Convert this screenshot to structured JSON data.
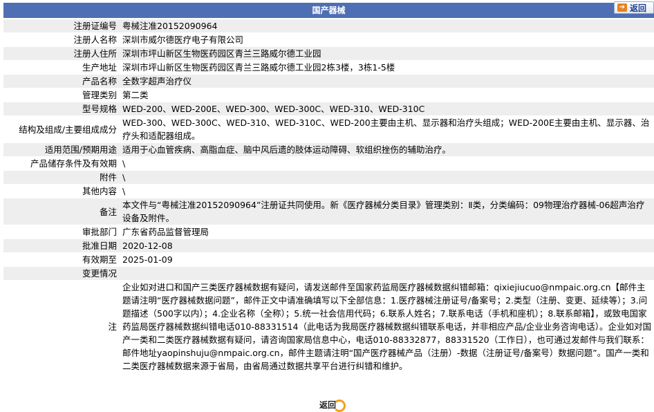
{
  "header": {
    "title": "国产器械",
    "back_label": "返回"
  },
  "rows": [
    {
      "label": "注册证编号",
      "value": "粤械注准20152090964"
    },
    {
      "label": "注册人名称",
      "value": "深圳市威尔德医疗电子有限公司"
    },
    {
      "label": "注册人住所",
      "value": "深圳市坪山新区生物医药园区青兰三路威尔德工业园"
    },
    {
      "label": "生产地址",
      "value": "深圳市坪山新区生物医药园区青兰三路威尔德工业园2栋3楼，3栋1-5楼"
    },
    {
      "label": "产品名称",
      "value": "全数字超声治疗仪"
    },
    {
      "label": "管理类别",
      "value": "第二类"
    },
    {
      "label": "型号规格",
      "value": "WED-200、WED-200E、WED-300、WED-300C、WED-310、WED-310C"
    },
    {
      "label": "结构及组成/主要组成成分",
      "value": "WED-300、WED-300C、WED-310、WED-310C、WED-200主要由主机、显示器和治疗头组成；WED-200E主要由主机、显示器、治疗头和适配器组成。"
    },
    {
      "label": "适用范围/预期用途",
      "value": "适用于心血管疾病、高脂血症、脑中风后遗的肢体运动障碍、软组织挫伤的辅助治疗。"
    },
    {
      "label": "产品储存条件及有效期",
      "value": "\\"
    },
    {
      "label": "附件",
      "value": "\\"
    },
    {
      "label": "其他内容",
      "value": "\\"
    },
    {
      "label": "备注",
      "value": "本文件与“粤械注准20152090964”注册证共同使用。新《医疗器械分类目录》管理类别：Ⅱ类，分类编码：09物理治疗器械-06超声治疗设备及附件。"
    },
    {
      "label": "审批部门",
      "value": "广东省药品监督管理局"
    },
    {
      "label": "批准日期",
      "value": "2020-12-08"
    },
    {
      "label": "有效期至",
      "value": "2025-01-09"
    },
    {
      "label": "变更情况",
      "value": ""
    },
    {
      "label": "注",
      "value": "企业如对进口和国产三类医疗器械数据有疑问，请发送邮件至国家药监局医疗器械数据纠错邮箱：qixiejiucuo@nmpaic.org.cn【邮件主题请注明“医疗器械数据问题”，邮件正文中请准确填写以下全部信息：1.医疗器械注册证号/备案号；2.类型（注册、变更、延续等）；3.问题描述（500字以内）；4.企业名称（全称）；5.统一社会信用代码；6.联系人姓名；7.联系电话（手机和座机）；8.联系邮箱】，或致电国家药监局医疗器械数据纠错电话010-88331514（此电话为我局医疗器械数据纠错联系电话，并非相应产品/企业业务咨询电话）。企业如对国产一类和二类医疗器械数据有疑问，请咨询国家局信息中心，电话010-88332877，88331520（工作日），也可通过发邮件与我们联系：邮件地址yaopinshuju@nmpaic.org.cn，邮件主题请注明“国产医疗器械产品（注册）-数据（注册证号/备案号）数据问题”。国产一类和二类医疗器械数据来源于省局，由省局通过数据共享平台进行纠错和维护。"
    }
  ],
  "footer": {
    "back_label": "返回"
  },
  "colors": {
    "header_bg": "#4f6fb4",
    "row_alt_bg": "#eeeeee",
    "accent_orange": "#f0a020"
  }
}
